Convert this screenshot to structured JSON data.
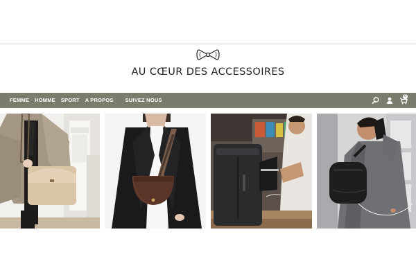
{
  "brand": {
    "name": "AU CŒUR DES ACCESSOIRES",
    "logo_icon": "bow-icon"
  },
  "nav": {
    "background": "#7b7d6c",
    "items": [
      {
        "label": "FEMME"
      },
      {
        "label": "HOMME"
      },
      {
        "label": "SPORT"
      },
      {
        "label": "A PROPOS"
      },
      {
        "label": "SUIVEZ NOUS"
      }
    ],
    "icons": [
      "search-icon",
      "account-icon",
      "cart-icon"
    ],
    "cart_count": "0"
  },
  "gallery": {
    "photos": [
      {
        "subject": "woman-beige-coat-beige-shoulder-bag"
      },
      {
        "subject": "woman-black-blazer-brown-saddle-bag"
      },
      {
        "subject": "man-laptop-black-backpack"
      },
      {
        "subject": "man-phone-black-sling-bag"
      }
    ]
  }
}
